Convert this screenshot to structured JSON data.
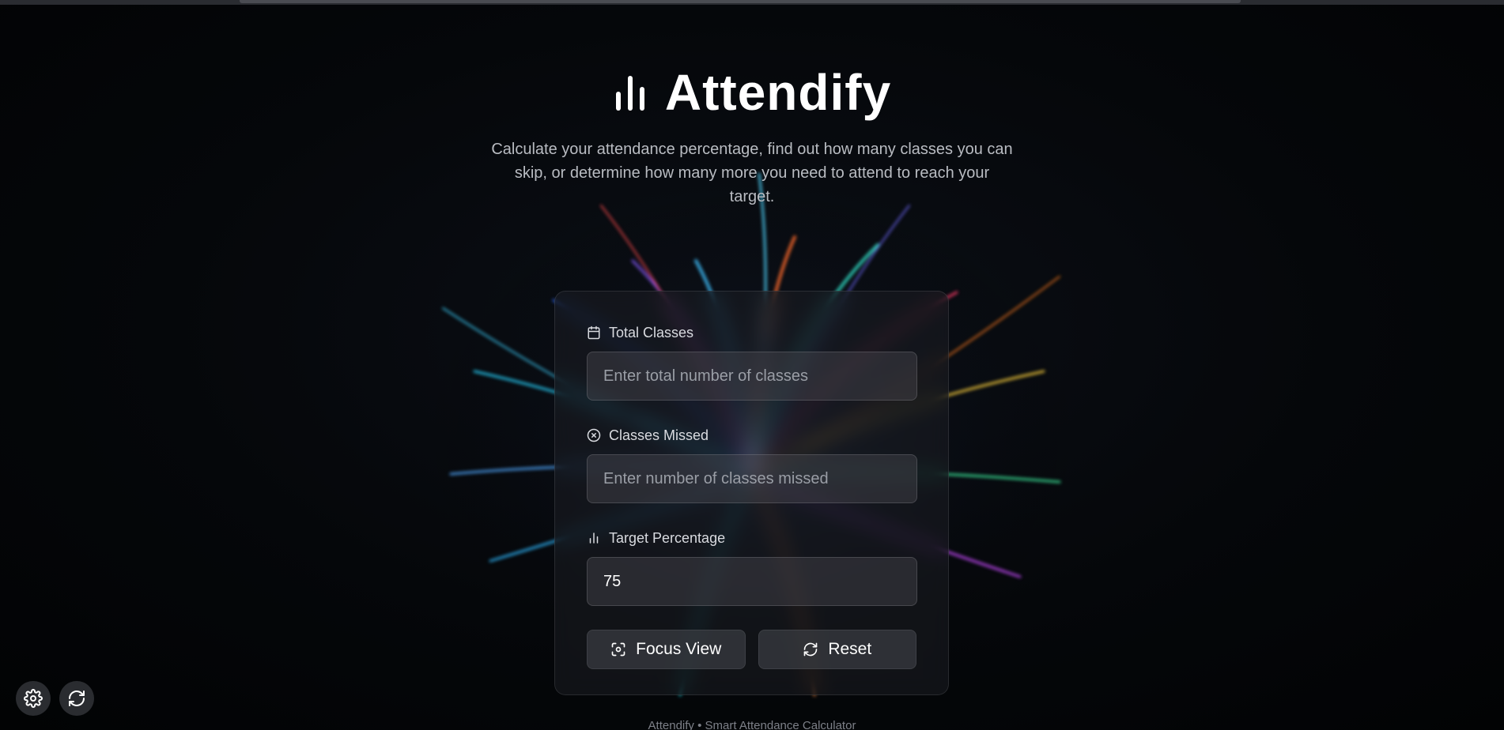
{
  "app": {
    "title": "Attendify",
    "subtitle": "Calculate your attendance percentage, find out how many classes you can skip, or determine how many more you need to attend to reach your target.",
    "footer": "Attendify • Smart Attendance Calculator"
  },
  "form": {
    "total_classes": {
      "label": "Total Classes",
      "placeholder": "Enter total number of classes",
      "value": "",
      "icon": "calendar-icon"
    },
    "classes_missed": {
      "label": "Classes Missed",
      "placeholder": "Enter number of classes missed",
      "value": "",
      "icon": "x-circle-icon"
    },
    "target_percentage": {
      "label": "Target Percentage",
      "placeholder": "",
      "value": "75",
      "icon": "bar-chart-icon"
    }
  },
  "buttons": {
    "focus_view": {
      "label": "Focus View",
      "icon": "focus-icon"
    },
    "reset": {
      "label": "Reset",
      "icon": "refresh-icon"
    }
  },
  "floating": {
    "settings_icon": "gear-icon",
    "refresh_icon": "refresh-icon"
  },
  "colors": {
    "background": "#05070a",
    "card": "#1c1e22",
    "text": "#ffffff",
    "muted": "#b9bcc2"
  }
}
